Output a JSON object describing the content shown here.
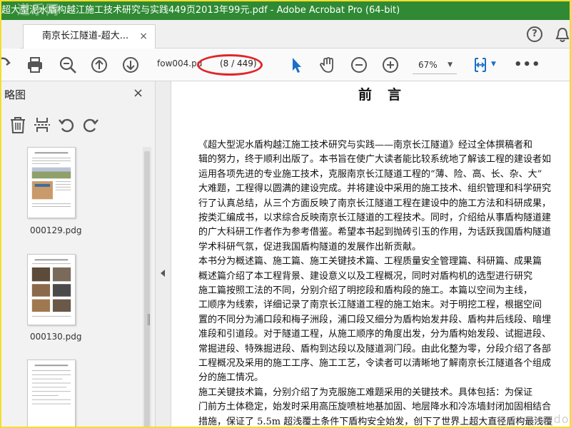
{
  "window": {
    "title": "超大型泥水盾构越江施工技术研究与实践449页2013年99元.pdf - Adobe Acrobat Pro (64-bit)",
    "overlay_mark": "道乐网"
  },
  "tabs": [
    {
      "label": "南京长江隧道-超大...",
      "close": "×"
    }
  ],
  "header": {
    "help": "?"
  },
  "toolbar": {
    "filename": "fow004.pd",
    "page_indicator": "(8 / 449)",
    "zoom": "67%",
    "zoom_arrow": "▼",
    "fit_arrow": "▼",
    "more": "•••",
    "accent_color": "#1a6fc9",
    "highlight_color": "#e0252a"
  },
  "sidebar": {
    "title": "略图",
    "close": "×",
    "thumbnails": [
      {
        "label": "000129.pdg"
      },
      {
        "label": "000130.pdg"
      }
    ]
  },
  "document": {
    "heading": "前言",
    "lines": [
      "《超大型泥水盾构越江施工技术研究与实践——南京长江隧道》经过全体撰稿者和",
      "辑的努力，终于顺利出版了。本书旨在使广大读者能比较系统地了解该工程的建设者如",
      "运用各项先进的专业施工技术，克服南京长江隧道工程的“薄、险、高、长、杂、大”",
      "大难题，工程得以圆满的建设完成。并将建设中采用的施工技术、组织管理和科学研究",
      "行了认真总结，从三个方面反映了南京长江隧道工程在建设中的施工方法和科研成果，",
      "按类汇编成书，以求综合反映南京长江隧道的工程技术。同时，介绍给从事盾构隧道建",
      "的广大科研工作者作为参考借鉴。希望本书起到抛砖引玉的作用，为话跃我国盾构隧道",
      "学术科研气氛，促进我国盾构隧道的发展作出新贡献。",
      "    本书分为概述篇、施工篇、施工关键技术篇、工程质量安全管理篇、科研篇、成果篇",
      "    概述篇介绍了本工程背景、建设意义以及工程概况，同时对盾构机的选型进行研究",
      "    施工篇按照工法的不同，分别介绍了明挖段和盾构段的施工。本篇以空间为主线，",
      "工顺序为线索，详细记录了南京长江隧道工程的施工始末。对于明挖工程，根据空间",
      "置的不同分为浦口段和梅子洲段，浦口段又细分为盾构始发井段、盾构井后线段、暗埋",
      "准段和引道段。对于隧道工程，从施工顺序的角度出发，分为盾构始发段、试掘进段、",
      "常掘进段、特殊掘进段、盾构到达段以及隧道洞门段。由此化整为零，分段介绍了各部",
      "工程概况及采用的施工工序、施工工艺，令读者可以清晰地了解南京长江隧道各个组成",
      "分的施工情况。",
      "    施工关键技术篇，分别介绍了为克服施工难题采用的关键技术。具体包括：为保证",
      "门前方土体稳定，始发时采用高压旋喷桩地基加固、地层降水和冷冻墙封闭加固相结合",
      "措施，保证了 5.5m 超浅覆土条件下盾构安全始发，创下了世界上超大直径盾构最浅覆"
    ]
  },
  "page_watermark": "www.onedoc.com"
}
